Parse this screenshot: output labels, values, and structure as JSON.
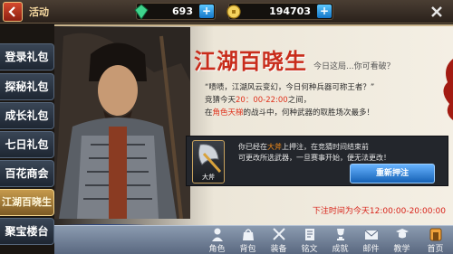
{
  "header": {
    "title": "活动",
    "gems": "693",
    "gold": "194703"
  },
  "sidebar": {
    "items": [
      {
        "label": "登录礼包",
        "active": false
      },
      {
        "label": "探秘礼包",
        "active": false
      },
      {
        "label": "成长礼包",
        "active": false
      },
      {
        "label": "七日礼包",
        "active": false
      },
      {
        "label": "百花商会",
        "active": false
      },
      {
        "label": "江湖百晓生",
        "active": true
      },
      {
        "label": "聚宝楼台",
        "active": false
      }
    ]
  },
  "event": {
    "title": "江湖百晓生",
    "subtitle": "今日这局...你可看破？",
    "quote_line1": "“啧啧，江湖风云变幻，今日何种兵器可称王者？”",
    "quote_line2_prefix": "竞猜今天",
    "quote_time": "20：00-22:00",
    "quote_line2_suffix": "之间，",
    "quote_line3_prefix": "在",
    "quote_arena": "角色天梯",
    "quote_line3_suffix": "的战斗中，何种武器的取胜场次最多！",
    "bet_prefix": "你已经在",
    "bet_weapon": "大斧",
    "bet_suffix": "上押注，在竞猜时间结束前",
    "bet_line2": "可更改所选武器，一旦赛事开始，便无法更改！",
    "weapon_name": "大斧",
    "rebet_label": "重新押注",
    "bet_time": "下注时间为今天12:00:00-20:00:00"
  },
  "nav": {
    "items": [
      {
        "label": "角色"
      },
      {
        "label": "背包"
      },
      {
        "label": "装备"
      },
      {
        "label": "铭文"
      },
      {
        "label": "成就"
      },
      {
        "label": "邮件"
      },
      {
        "label": "教学"
      },
      {
        "label": "首页"
      }
    ]
  },
  "colors": {
    "accent_red": "#c82c1b",
    "button_blue": "#1561b5",
    "active_tab": "#c69a4c"
  }
}
